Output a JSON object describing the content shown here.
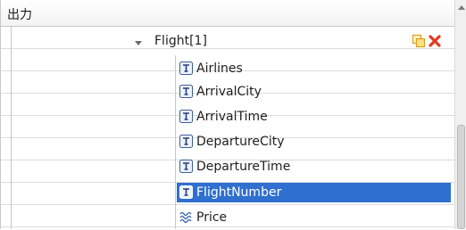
{
  "panel": {
    "title": "出力"
  },
  "tree": {
    "root": {
      "label": "Flight[1]",
      "expanded": true
    },
    "fields": [
      {
        "label": "Airlines",
        "icon": "text-field-icon",
        "selected": false
      },
      {
        "label": "ArrivalCity",
        "icon": "text-field-icon",
        "selected": false
      },
      {
        "label": "ArrivalTime",
        "icon": "text-field-icon",
        "selected": false
      },
      {
        "label": "DepartureCity",
        "icon": "text-field-icon",
        "selected": false
      },
      {
        "label": "DepartureTime",
        "icon": "text-field-icon",
        "selected": false
      },
      {
        "label": "FlightNumber",
        "icon": "text-field-icon",
        "selected": true
      },
      {
        "label": "Price",
        "icon": "numeric-field-icon",
        "selected": false
      }
    ]
  },
  "colors": {
    "selection": "#2f6fcf",
    "delete": "#e23a1e",
    "copy": "#d9a21b"
  }
}
